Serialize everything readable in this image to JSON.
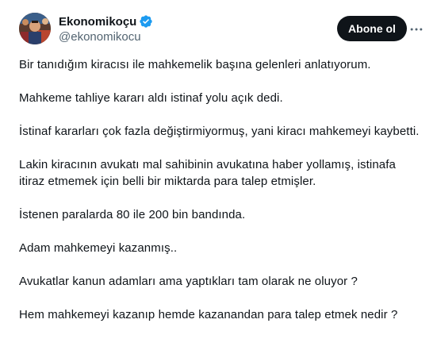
{
  "author": {
    "display_name": "Ekonomikoçu",
    "handle": "@ekonomikocu",
    "verified": true,
    "avatar": "avatar-photo"
  },
  "actions": {
    "follow_label": "Abone ol",
    "more_icon": "more-horizontal-icon"
  },
  "tweet": {
    "paragraphs": [
      "Bir tanıdığım kiracısı ile mahkemelik başına gelenleri anlatıyorum.",
      "Mahkeme tahliye kararı aldı istinaf yolu açık dedi.",
      "İstinaf kararları çok fazla değiştirmiyormuş, yani kiracı mahkemeyi kaybetti.",
      "Lakin kiracının avukatı mal sahibinin avukatına haber yollamış, istinafa itiraz etmemek için belli bir miktarda para talep etmişler.",
      "İstenen paralarda 80 ile 200 bin bandında.",
      "Adam mahkemeyi kazanmış..",
      "Avukatlar kanun adamları ama yaptıkları tam olarak ne oluyor ?",
      "Hem mahkemeyi kazanıp hemde kazanandan para talep etmek nedir ?"
    ]
  },
  "colors": {
    "text": "#0f1419",
    "secondary": "#536471",
    "verified": "#1d9bf0",
    "button_bg": "#0f1419",
    "button_text": "#ffffff"
  }
}
